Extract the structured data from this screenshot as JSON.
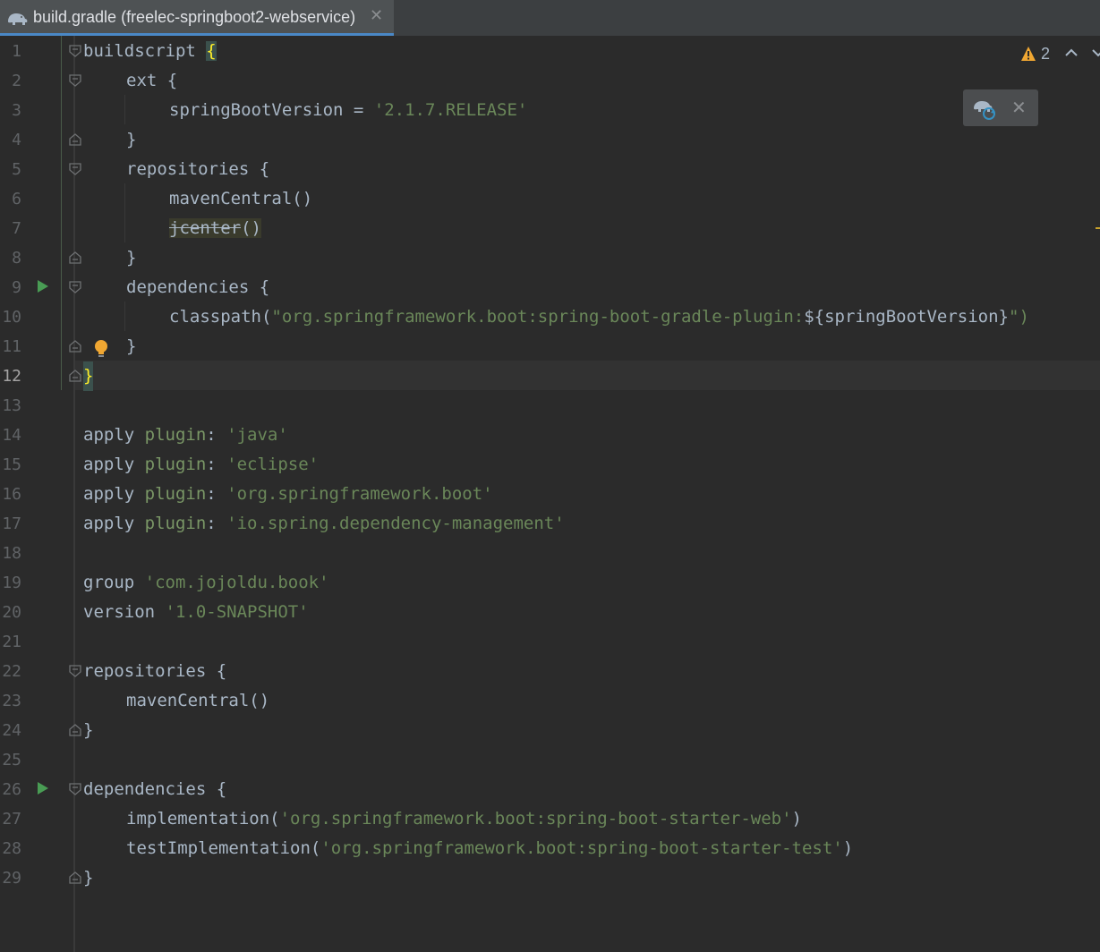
{
  "tab": {
    "icon": "gradle-elephant-icon",
    "title": "build.gradle (freelec-springboot2-webservice)",
    "close": "✕"
  },
  "inspection": {
    "warning_count": "2"
  },
  "sync_popup": {
    "icon": "gradle-sync-icon",
    "close": "✕"
  },
  "editor": {
    "current_line": 12,
    "lines": [
      {
        "no": "1",
        "text": "buildscript {"
      },
      {
        "no": "2",
        "text": "    ext {"
      },
      {
        "no": "3",
        "text": "        springBootVersion = '2.1.7.RELEASE'"
      },
      {
        "no": "4",
        "text": "    }"
      },
      {
        "no": "5",
        "text": "    repositories {"
      },
      {
        "no": "6",
        "text": "        mavenCentral()"
      },
      {
        "no": "7",
        "text": "        jcenter()"
      },
      {
        "no": "8",
        "text": "    }"
      },
      {
        "no": "9",
        "text": "    dependencies {"
      },
      {
        "no": "10",
        "text": "        classpath(\"org.springframework.boot:spring-boot-gradle-plugin:${springBootVersion}\")"
      },
      {
        "no": "11",
        "text": "    }"
      },
      {
        "no": "12",
        "text": "}"
      },
      {
        "no": "13",
        "text": ""
      },
      {
        "no": "14",
        "text": "apply plugin: 'java'"
      },
      {
        "no": "15",
        "text": "apply plugin: 'eclipse'"
      },
      {
        "no": "16",
        "text": "apply plugin: 'org.springframework.boot'"
      },
      {
        "no": "17",
        "text": "apply plugin: 'io.spring.dependency-management'"
      },
      {
        "no": "18",
        "text": ""
      },
      {
        "no": "19",
        "text": "group 'com.jojoldu.book'"
      },
      {
        "no": "20",
        "text": "version '1.0-SNAPSHOT'"
      },
      {
        "no": "21",
        "text": ""
      },
      {
        "no": "22",
        "text": "repositories {"
      },
      {
        "no": "23",
        "text": "    mavenCentral()"
      },
      {
        "no": "24",
        "text": "}"
      },
      {
        "no": "25",
        "text": ""
      },
      {
        "no": "26",
        "text": "dependencies {"
      },
      {
        "no": "27",
        "text": "    implementation('org.springframework.boot:spring-boot-starter-web')"
      },
      {
        "no": "28",
        "text": "    testImplementation('org.springframework.boot:spring-boot-starter-test')"
      },
      {
        "no": "29",
        "text": "}"
      }
    ],
    "tokens": {
      "l1_kw": "buildscript ",
      "l1_brace": "{",
      "l2_kw": "ext {",
      "l3_name": "springBootVersion = ",
      "l3_str": "'2.1.7.RELEASE'",
      "l4": "}",
      "l5": "repositories {",
      "l6": "mavenCentral()",
      "l7_struck": "jcenter",
      "l7_paren": "()",
      "l8": "}",
      "l9": "dependencies {",
      "l10_a": "classpath(",
      "l10_str": "\"org.springframework.boot:spring-boot-gradle-plugin:",
      "l10_interp": "${springBootVersion}",
      "l10_end": "\")",
      "l11": "}",
      "l12": "}",
      "apply": "apply ",
      "plugin": "plugin",
      "colon": ": ",
      "l14_str": "'java'",
      "l15_str": "'eclipse'",
      "l16_str": "'org.springframework.boot'",
      "l17_str": "'io.spring.dependency-management'",
      "l19_kw": "group ",
      "l19_str": "'com.jojoldu.book'",
      "l20_kw": "version ",
      "l20_str": "'1.0-SNAPSHOT'",
      "l22": "repositories {",
      "l23": "mavenCentral()",
      "l24": "}",
      "l26": "dependencies {",
      "l27_a": "implementation(",
      "l27_str": "'org.springframework.boot:spring-boot-starter-web'",
      "l27_end": ")",
      "l28_a": "testImplementation(",
      "l28_str": "'org.springframework.boot:spring-boot-starter-test'",
      "l28_end": ")",
      "l29": "}"
    }
  },
  "colors": {
    "background": "#2b2b2b",
    "string": "#6a8759",
    "text": "#a9b7c6",
    "line_number": "#606366",
    "brace_highlight": "#ffef28",
    "tab_underline": "#4a88c7",
    "warning": "#f0a732"
  }
}
